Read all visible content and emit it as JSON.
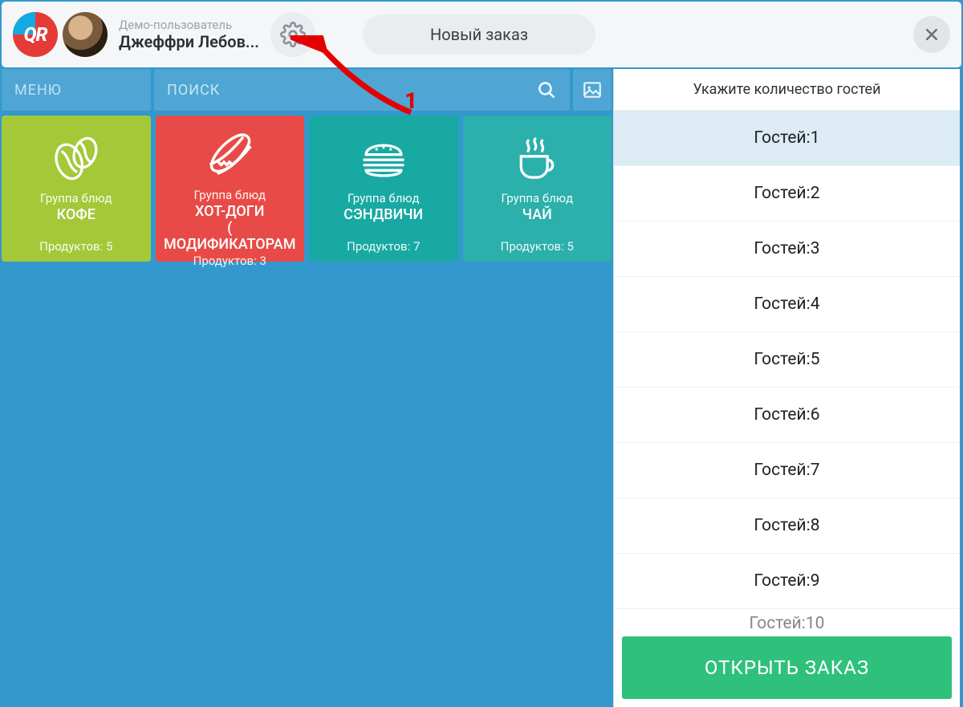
{
  "header": {
    "logo_text": "QR",
    "user_role": "Демо-пользователь",
    "user_name": "Джеффри Лебов...",
    "order_title": "Новый заказ"
  },
  "annotation": {
    "label": "1"
  },
  "menu": {
    "menu_label": "МЕНЮ",
    "search_placeholder": "ПОИСК"
  },
  "group_label": "Группа блюд",
  "products_prefix": "Продуктов: ",
  "tiles": [
    {
      "name": "КОФЕ",
      "count": "5",
      "color": "tile-green",
      "icon": "coffee-bean-icon"
    },
    {
      "name": "ХОТ-ДОГИ\n( МОДИФИКАТОРАМ",
      "count": "3",
      "color": "tile-red",
      "icon": "hotdog-icon"
    },
    {
      "name": "СЭНДВИЧИ",
      "count": "7",
      "color": "tile-teal1",
      "icon": "burger-icon"
    },
    {
      "name": "ЧАЙ",
      "count": "5",
      "color": "tile-teal2",
      "icon": "tea-icon"
    }
  ],
  "guests": {
    "header": "Укажите количество гостей",
    "row_prefix": "Гостей: ",
    "selected_index": 0,
    "rows": [
      "1",
      "2",
      "3",
      "4",
      "5",
      "6",
      "7",
      "8",
      "9",
      "10"
    ]
  },
  "open_order_label": "ОТКРЫТЬ ЗАКАЗ",
  "colors": {
    "bg": "#3398cd",
    "accent_green": "#2fc17b",
    "arrow": "#e40000"
  }
}
